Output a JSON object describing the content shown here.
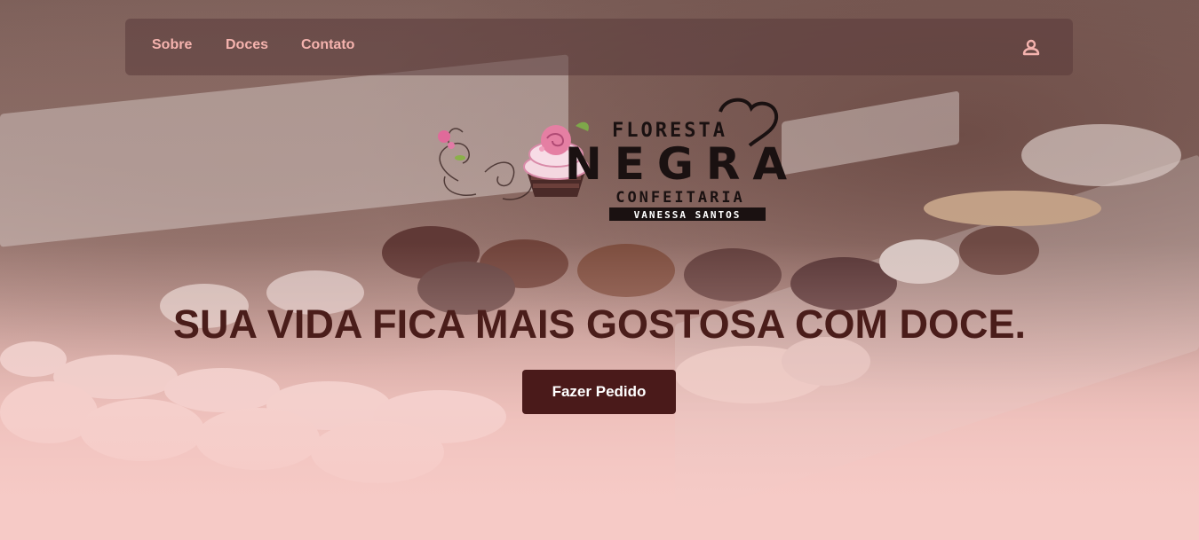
{
  "nav": {
    "links": [
      {
        "label": "Sobre"
      },
      {
        "label": "Doces"
      },
      {
        "label": "Contato"
      }
    ],
    "user_icon": "user-icon"
  },
  "logo": {
    "line1": "FLORESTA",
    "line2": "NEGRA",
    "line3": "CONFEITARIA",
    "line4": "VANESSA SANTOS"
  },
  "hero": {
    "headline": "SUA VIDA FICA MAIS GOSTOSA COM DOCE.",
    "cta_label": "Fazer Pedido"
  },
  "colors": {
    "accent": "#f5b3ae",
    "headline": "#4a1d1a",
    "button": "#4a1a1a",
    "background": "#f6cac6"
  }
}
